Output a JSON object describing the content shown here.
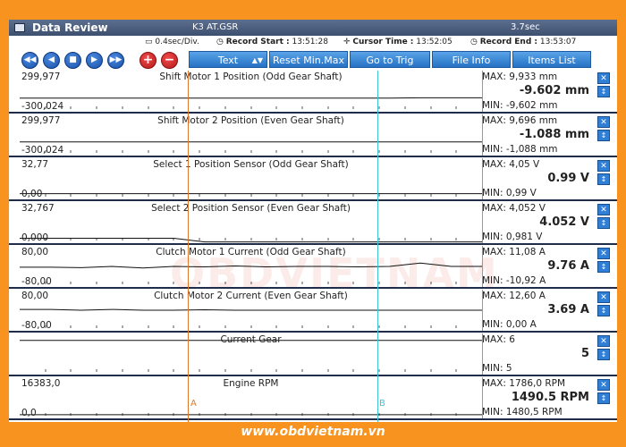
{
  "window": {
    "title": "Data Review",
    "file": "K3 AT.GSR",
    "duration": "3.7sec"
  },
  "info": {
    "div": "0.4sec/Div.",
    "record_start_label": "Record Start :",
    "record_start": "13:51:28",
    "cursor_time_label": "Cursor Time :",
    "cursor_time": "13:52:05",
    "record_end_label": "Record End :",
    "record_end": "13:53:07"
  },
  "toolbar": {
    "nav_icons": [
      "rewind-icon",
      "prev-icon",
      "stop-icon",
      "next-icon",
      "fast-forward-icon"
    ],
    "add_label": "+",
    "remove_label": "−",
    "text_select": "Text",
    "reset_minmax": "Reset Min.Max",
    "goto_trig": "Go to Trig",
    "file_info": "File Info",
    "items_list": "Items List"
  },
  "panels": [
    {
      "title": "Shift Motor 1 Position (Odd Gear Shaft)",
      "ymax": "299,977",
      "ymin": "-300,024",
      "max": "MAX: 9,933 mm",
      "current": "-9.602 mm",
      "min": "MIN: -9,602 mm",
      "trace": [
        0.33,
        0.33,
        0.33,
        0.33,
        0.33,
        0.33,
        0.33,
        0.33,
        0.33,
        0.33,
        0.33,
        0.33,
        0.33,
        0.34,
        0.34,
        0.34
      ]
    },
    {
      "title": "Shift Motor 2 Position (Even Gear Shaft)",
      "ymax": "299,977",
      "ymin": "-300,024",
      "max": "MAX: 9,696 mm",
      "current": "-1.088 mm",
      "min": "MIN: -1,088 mm",
      "trace": [
        0.33,
        0.33,
        0.33,
        0.33,
        0.33,
        0.33,
        0.33,
        0.33,
        0.33,
        0.33,
        0.33,
        0.33,
        0.33,
        0.33,
        0.33,
        0.33
      ]
    },
    {
      "title": "Select 1 Position Sensor (Odd Gear Shaft)",
      "ymax": "32,77",
      "ymin": "0,00",
      "max": "MAX:  4,05 V",
      "current": "0.99 V",
      "min": "MIN:  0,99 V",
      "trace": [
        0.14,
        0.14,
        0.14,
        0.14,
        0.14,
        0.14,
        0.14,
        0.14,
        0.14,
        0.14,
        0.14,
        0.14,
        0.14,
        0.14,
        0.14,
        0.14
      ]
    },
    {
      "title": "Select 2 Position Sensor (Even Gear Shaft)",
      "ymax": "32,767",
      "ymin": "0,000",
      "max": "MAX: 4,052 V",
      "current": "4.052 V",
      "min": "MIN: 0,981 V",
      "trace": [
        0.12,
        0.12,
        0.12,
        0.12,
        0.12,
        0.12,
        0.03,
        0.03,
        0.03,
        0.03,
        0.03,
        0.03,
        0.03,
        0.03,
        0.03,
        0.03
      ]
    },
    {
      "title": "Clutch Motor 1 Current (Odd Gear Shaft)",
      "ymax": "80,00",
      "ymin": "-80,00",
      "max": "MAX: 11,08 A",
      "current": "9.76 A",
      "min": "MIN: -10,92 A",
      "trace": [
        0.48,
        0.48,
        0.47,
        0.5,
        0.46,
        0.5,
        0.49,
        0.51,
        0.49,
        0.5,
        0.5,
        0.49,
        0.5,
        0.58,
        0.5,
        0.5
      ]
    },
    {
      "title": "Clutch Motor 2 Current (Even Gear Shaft)",
      "ymax": "80,00",
      "ymin": "-80,00",
      "max": "MAX: 12,60 A",
      "current": "3.69 A",
      "min": "MIN: 0,00 A",
      "trace": [
        0.52,
        0.52,
        0.5,
        0.52,
        0.5,
        0.5,
        0.51,
        0.5,
        0.5,
        0.5,
        0.5,
        0.5,
        0.5,
        0.5,
        0.5,
        0.5
      ]
    },
    {
      "title": "Current Gear",
      "ymax": "",
      "ymin": "",
      "max": "MAX: 6",
      "current": "5",
      "min": "MIN: 5",
      "trace": [
        0.83,
        0.83,
        0.83,
        0.83,
        0.83,
        0.83,
        0.83,
        0.83,
        0.83,
        0.83,
        0.83,
        0.83,
        0.83,
        0.83,
        0.83,
        0.83
      ]
    },
    {
      "title": "Engine RPM",
      "ymax": "16383,0",
      "ymin": "0,0",
      "max": "MAX: 1786,0 RPM",
      "current": "1490.5 RPM",
      "min": "MIN: 1480,5 RPM",
      "trace": [
        0.09,
        0.09,
        0.09,
        0.09,
        0.09,
        0.09,
        0.09,
        0.09,
        0.09,
        0.09,
        0.09,
        0.09,
        0.09,
        0.09,
        0.09,
        0.09
      ]
    }
  ],
  "cursors": {
    "a": "A",
    "b": "B"
  },
  "watermark": "OBDVIETNAM",
  "footer": "www.obdvietnam.vn",
  "colors": {
    "frame": "#f7931e",
    "title_bg": "#3e5070",
    "button_blue": "#2672c4",
    "cursor_a": "#e07a2a",
    "cursor_b": "#3cc6d8"
  }
}
